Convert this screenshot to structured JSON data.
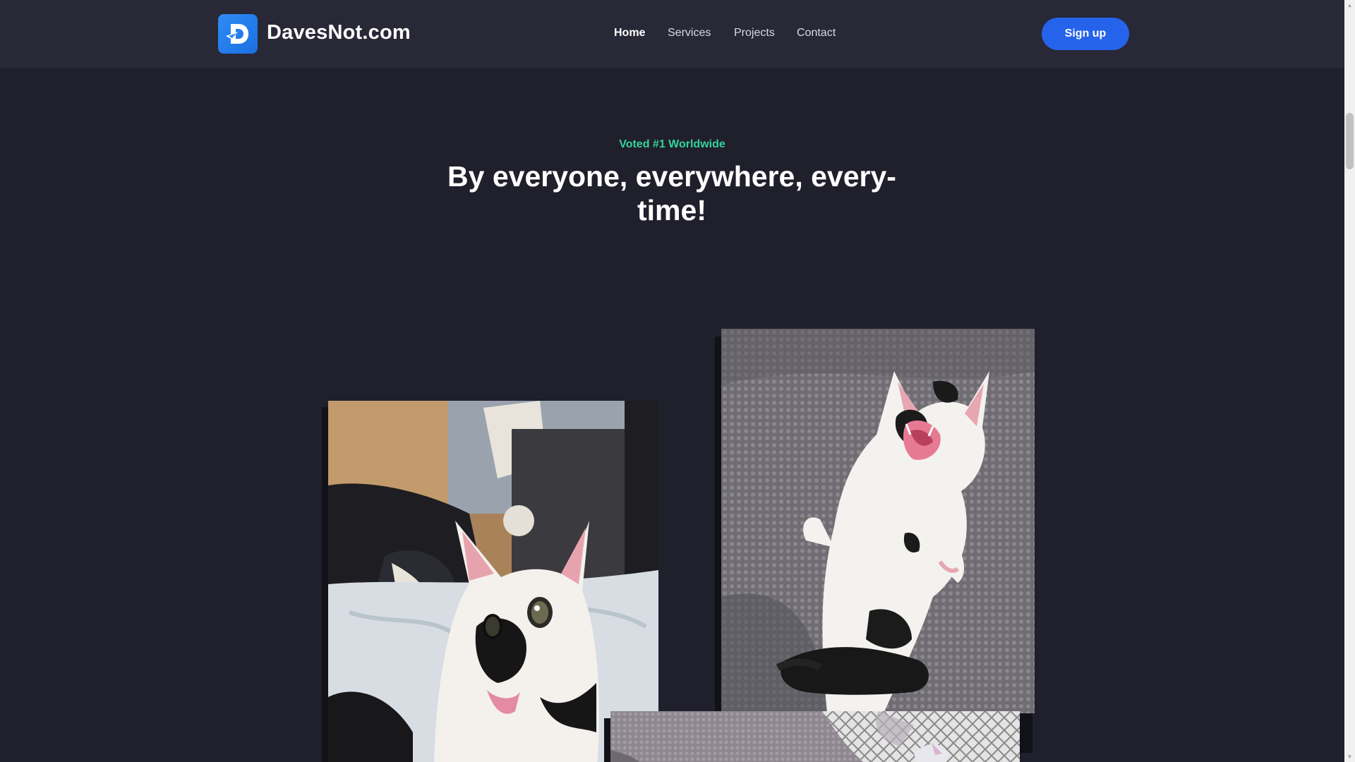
{
  "brand": {
    "name": "DavesNot.com",
    "logo_icon": "d-logo-icon"
  },
  "nav": {
    "items": [
      {
        "label": "Home",
        "active": true
      },
      {
        "label": "Services",
        "active": false
      },
      {
        "label": "Projects",
        "active": false
      },
      {
        "label": "Contact",
        "active": false
      }
    ]
  },
  "header": {
    "signup_label": "Sign up"
  },
  "hero": {
    "eyebrow": "Voted #1 Worldwide",
    "title_line1": "By everyone, everywhere, every-",
    "title_line2": "time!"
  },
  "gallery": {
    "photos": [
      {
        "name": "cat-tongue-out-photo"
      },
      {
        "name": "cat-yawning-on-blanket-photo"
      },
      {
        "name": "cat-on-pillow-photo"
      }
    ]
  },
  "colors": {
    "background": "#201f2c",
    "header_bg": "#282837",
    "accent_button": "#2563eb",
    "eyebrow_green": "#34d399"
  }
}
